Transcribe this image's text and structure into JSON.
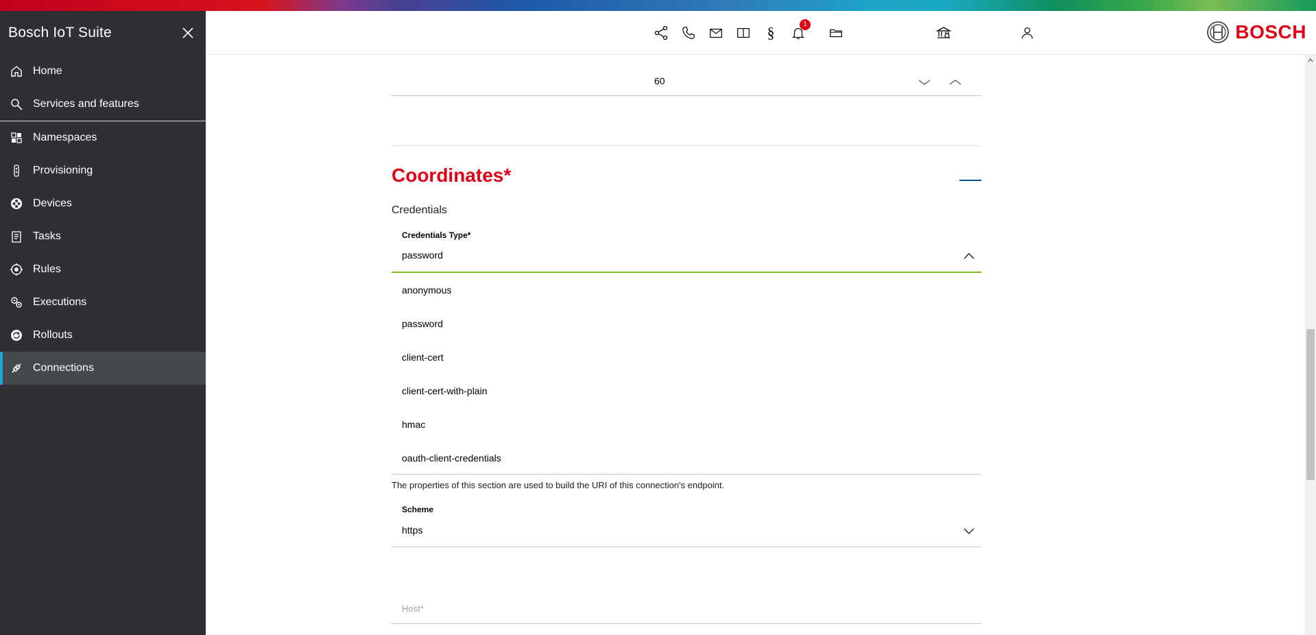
{
  "sidebar": {
    "title": "Bosch IoT Suite",
    "items": [
      {
        "label": "Home",
        "icon": "home-icon"
      },
      {
        "label": "Services and features",
        "icon": "search-icon"
      },
      {
        "label": "Namespaces",
        "icon": "namespaces-icon"
      },
      {
        "label": "Provisioning",
        "icon": "provisioning-icon"
      },
      {
        "label": "Devices",
        "icon": "devices-icon"
      },
      {
        "label": "Tasks",
        "icon": "tasks-icon"
      },
      {
        "label": "Rules",
        "icon": "rules-icon"
      },
      {
        "label": "Executions",
        "icon": "executions-icon"
      },
      {
        "label": "Rollouts",
        "icon": "rollouts-icon"
      },
      {
        "label": "Connections",
        "icon": "connections-icon",
        "active": true
      }
    ]
  },
  "header": {
    "notification_count": "1",
    "brand": "BOSCH",
    "section_symbol": "§"
  },
  "form": {
    "number_value": "60",
    "section_title": "Coordinates*",
    "credentials_label": "Credentials",
    "credentials_type": {
      "label": "Credentials Type*",
      "value": "password",
      "options": [
        "anonymous",
        "password",
        "client-cert",
        "client-cert-with-plain",
        "hmac",
        "oauth-client-credentials"
      ]
    },
    "help_text": "The properties of this section are used to build the URI of this connection's endpoint.",
    "scheme": {
      "label": "Scheme",
      "value": "https"
    },
    "host": {
      "placeholder": "Host*",
      "value": ""
    }
  },
  "colors": {
    "brand_red": "#e20015",
    "sidebar_bg": "#2e3033",
    "active_accent": "#19a9e0",
    "focus_green": "#78be20"
  }
}
